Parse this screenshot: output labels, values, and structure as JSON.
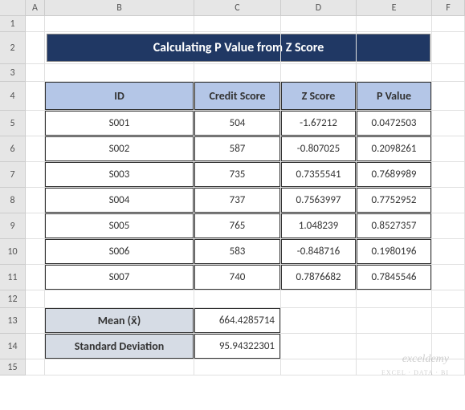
{
  "columns": [
    "A",
    "B",
    "C",
    "D",
    "E",
    "F"
  ],
  "rows": [
    "1",
    "2",
    "3",
    "4",
    "5",
    "6",
    "7",
    "8",
    "9",
    "10",
    "11",
    "12",
    "13",
    "14",
    "15"
  ],
  "title": "Calculating P Value from Z Score",
  "headers": {
    "id": "ID",
    "credit": "Credit Score",
    "z": "Z Score",
    "p": "P Value"
  },
  "data": [
    {
      "id": "S001",
      "credit": "504",
      "z": "-1.67212",
      "p": "0.0472503"
    },
    {
      "id": "S002",
      "credit": "587",
      "z": "-0.807025",
      "p": "0.2098261"
    },
    {
      "id": "S003",
      "credit": "735",
      "z": "0.7355541",
      "p": "0.7689989"
    },
    {
      "id": "S004",
      "credit": "737",
      "z": "0.7563997",
      "p": "0.7752952"
    },
    {
      "id": "S005",
      "credit": "765",
      "z": "1.048239",
      "p": "0.8527357"
    },
    {
      "id": "S006",
      "credit": "583",
      "z": "-0.848716",
      "p": "0.1980196"
    },
    {
      "id": "S007",
      "credit": "740",
      "z": "0.7876682",
      "p": "0.7845546"
    }
  ],
  "stats": {
    "mean_label": "Mean (x̄)",
    "mean_value": "664.4285714",
    "sd_label": "Standard Deviation",
    "sd_value": "95.94322301"
  },
  "watermark": {
    "main": "exceldemy",
    "sub": "EXCEL · DATA · BI"
  }
}
